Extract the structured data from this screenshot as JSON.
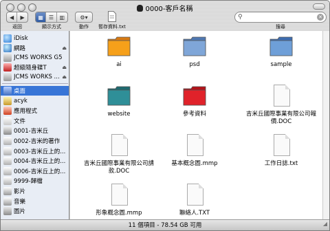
{
  "window": {
    "title": "0000-客戶名稱"
  },
  "toolbar": {
    "back_label": "返回",
    "view_label": "顯示方式",
    "action_label": "動作",
    "file_label": "暫存資料.txt",
    "search_label": "搜尋",
    "search_value": ""
  },
  "sidebar": {
    "devices": [
      {
        "label": "iDisk",
        "icon": "globe-icon",
        "eject": false
      },
      {
        "label": "網路",
        "icon": "network-globe-icon",
        "eject": true
      },
      {
        "label": "JCMS WORKS G5",
        "icon": "hard-drive-icon",
        "eject": false
      },
      {
        "label": "超級隨身碟T",
        "icon": "usb-drive-icon",
        "eject": true
      },
      {
        "label": "JCMS WORKS ...",
        "icon": "hard-drive-icon",
        "eject": true
      }
    ],
    "places": [
      {
        "label": "桌面",
        "icon": "desktop-icon",
        "selected": true
      },
      {
        "label": "acyk",
        "icon": "home-icon",
        "selected": false
      },
      {
        "label": "應用程式",
        "icon": "applications-icon",
        "selected": false
      },
      {
        "label": "文件",
        "icon": "documents-folder-icon",
        "selected": false
      },
      {
        "label": "0001-吉米丘",
        "icon": "folder-j-icon",
        "selected": false
      },
      {
        "label": "0002-吉米的著作",
        "icon": "folder-icon",
        "selected": false
      },
      {
        "label": "0003-吉米丘上的...",
        "icon": "folder-icon",
        "selected": false
      },
      {
        "label": "0004-吉米丘上的...",
        "icon": "folder-icon",
        "selected": false
      },
      {
        "label": "0006-吉米丘上的...",
        "icon": "folder-icon",
        "selected": false
      },
      {
        "label": "9999-歸檔",
        "icon": "folder-icon",
        "selected": false
      },
      {
        "label": "影片",
        "icon": "movies-icon",
        "selected": false
      },
      {
        "label": "音樂",
        "icon": "music-icon",
        "selected": false
      },
      {
        "label": "圖片",
        "icon": "pictures-icon",
        "selected": false
      }
    ]
  },
  "files": [
    {
      "name": "ai",
      "icon": "ai-folder-icon"
    },
    {
      "name": "psd",
      "icon": "psd-folder-icon"
    },
    {
      "name": "sample",
      "icon": "sample-folder-icon"
    },
    {
      "name": "website",
      "icon": "website-folder-icon"
    },
    {
      "name": "參考資料",
      "icon": "red-folder-icon"
    },
    {
      "name": "吉米丘國際事業有限公司報價.DOC",
      "icon": "document-icon"
    },
    {
      "name": "吉米丘國際事業有限公司請款.DOC",
      "icon": "document-icon"
    },
    {
      "name": "基本概念圖.mmp",
      "icon": "document-icon"
    },
    {
      "name": "工作日誌.txt",
      "icon": "document-icon"
    },
    {
      "name": "形象概念圖.mmp",
      "icon": "document-icon"
    },
    {
      "name": "聯絡人.TXT",
      "icon": "text-document-icon"
    }
  ],
  "status": {
    "text": "11 個項目 - 78.54 GB 可用"
  },
  "colors": {
    "selection": "#3875d7",
    "sidebar_bg": "#e8edf5"
  }
}
